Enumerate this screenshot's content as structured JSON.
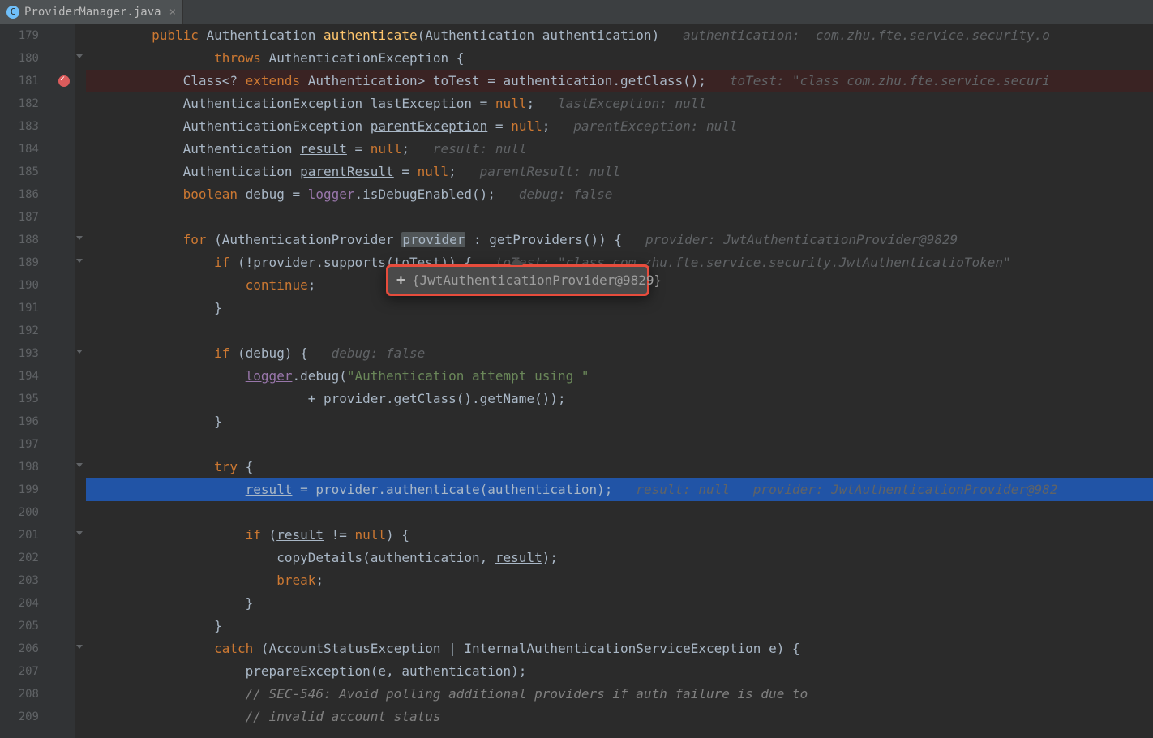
{
  "tab": {
    "name": "ProviderManager.java",
    "icon_letter": "C"
  },
  "line_numbers": [
    "179",
    "180",
    "181",
    "182",
    "183",
    "184",
    "185",
    "186",
    "187",
    "188",
    "189",
    "190",
    "191",
    "192",
    "193",
    "194",
    "195",
    "196",
    "197",
    "198",
    "199",
    "200",
    "201",
    "202",
    "203",
    "204",
    "205",
    "206",
    "207",
    "208",
    "209"
  ],
  "breakpoint_line": "181",
  "current_line": "199",
  "tooltip": {
    "text": "{JwtAuthenticationProvider@9829}",
    "plus": "+"
  },
  "tooltip_style": "left:370px; top:296px; width:325px;",
  "code": {
    "l179": {
      "indent": "        ",
      "kw_public": "public",
      "type1": " Authentication ",
      "method": "authenticate",
      "params": "(Authentication authentication)",
      "hint": "   authentication:  com.zhu.fte.service.security.o"
    },
    "l180": {
      "indent": "                ",
      "kw_throws": "throws",
      "exc": " AuthenticationException {"
    },
    "l181": {
      "indent": "            ",
      "t": "Class<? ",
      "kw_extends": "extends",
      "t2": " Authentication> toTest = authentication.getClass();",
      "hint": "   toTest: \"class com.zhu.fte.service.securi"
    },
    "l182": {
      "indent": "            ",
      "t": "AuthenticationException ",
      "u": "lastException",
      "t2": " = ",
      "nul": "null",
      "t3": ";",
      "hint": "   lastException: null"
    },
    "l183": {
      "indent": "            ",
      "t": "AuthenticationException ",
      "u": "parentException",
      "t2": " = ",
      "nul": "null",
      "t3": ";",
      "hint": "   parentException: null"
    },
    "l184": {
      "indent": "            ",
      "t": "Authentication ",
      "u": "result",
      "t2": " = ",
      "nul": "null",
      "t3": ";",
      "hint": "   result: null"
    },
    "l185": {
      "indent": "            ",
      "t": "Authentication ",
      "u": "parentResult",
      "t2": " = ",
      "nul": "null",
      "t3": ";",
      "hint": "   parentResult: null"
    },
    "l186": {
      "indent": "            ",
      "kw": "boolean",
      "t": " debug = ",
      "field": "logger",
      "t2": ".isDebugEnabled();",
      "hint": "   debug: false"
    },
    "l188": {
      "indent": "            ",
      "kw": "for",
      "t": " (AuthenticationProvider ",
      "var": "provider",
      "t2": " : getProviders()) {",
      "hint": "   provider: JwtAuthenticationProvider@9829"
    },
    "l189": {
      "indent": "                ",
      "kw": "if",
      "t": " (!provider.supports(toTest)) {",
      "hint": "   toTest: \"class com.zhu.fte.service.security.JwtAuthenticatioToken\""
    },
    "l190": {
      "indent": "                    ",
      "kw": "continue",
      "t": ";"
    },
    "l191": {
      "indent": "                ",
      "t": "}"
    },
    "l193": {
      "indent": "                ",
      "kw": "if",
      "t": " (debug) {",
      "hint": "   debug: false"
    },
    "l194": {
      "indent": "                    ",
      "field": "logger",
      "t": ".debug(",
      "str": "\"Authentication attempt using \""
    },
    "l195": {
      "indent": "                            ",
      "t": "+ provider.getClass().getName());"
    },
    "l196": {
      "indent": "                ",
      "t": "}"
    },
    "l198": {
      "indent": "                ",
      "kw": "try",
      "t": " {"
    },
    "l199": {
      "indent": "                    ",
      "u": "result",
      "t": " = provider.authenticate(authentication);",
      "hint": "   result: null   provider: JwtAuthenticationProvider@982"
    },
    "l201": {
      "indent": "                    ",
      "kw": "if",
      "t": " (",
      "u": "result",
      "t2": " != ",
      "nul": "null",
      "t3": ") {"
    },
    "l202": {
      "indent": "                        ",
      "t": "copyDetails(authentication, ",
      "u": "result",
      "t2": ");"
    },
    "l203": {
      "indent": "                        ",
      "kw": "break",
      "t": ";"
    },
    "l204": {
      "indent": "                    ",
      "t": "}"
    },
    "l205": {
      "indent": "                ",
      "t": "}"
    },
    "l206": {
      "indent": "                ",
      "kw": "catch",
      "t": " (AccountStatusException | InternalAuthenticationServiceException e) {"
    },
    "l207": {
      "indent": "                    ",
      "t": "prepareException(e, authentication);"
    },
    "l208": {
      "indent": "                    ",
      "comment": "// SEC-546: Avoid polling additional providers if auth failure is due to"
    },
    "l209": {
      "indent": "                    ",
      "comment": "// invalid account status"
    }
  }
}
